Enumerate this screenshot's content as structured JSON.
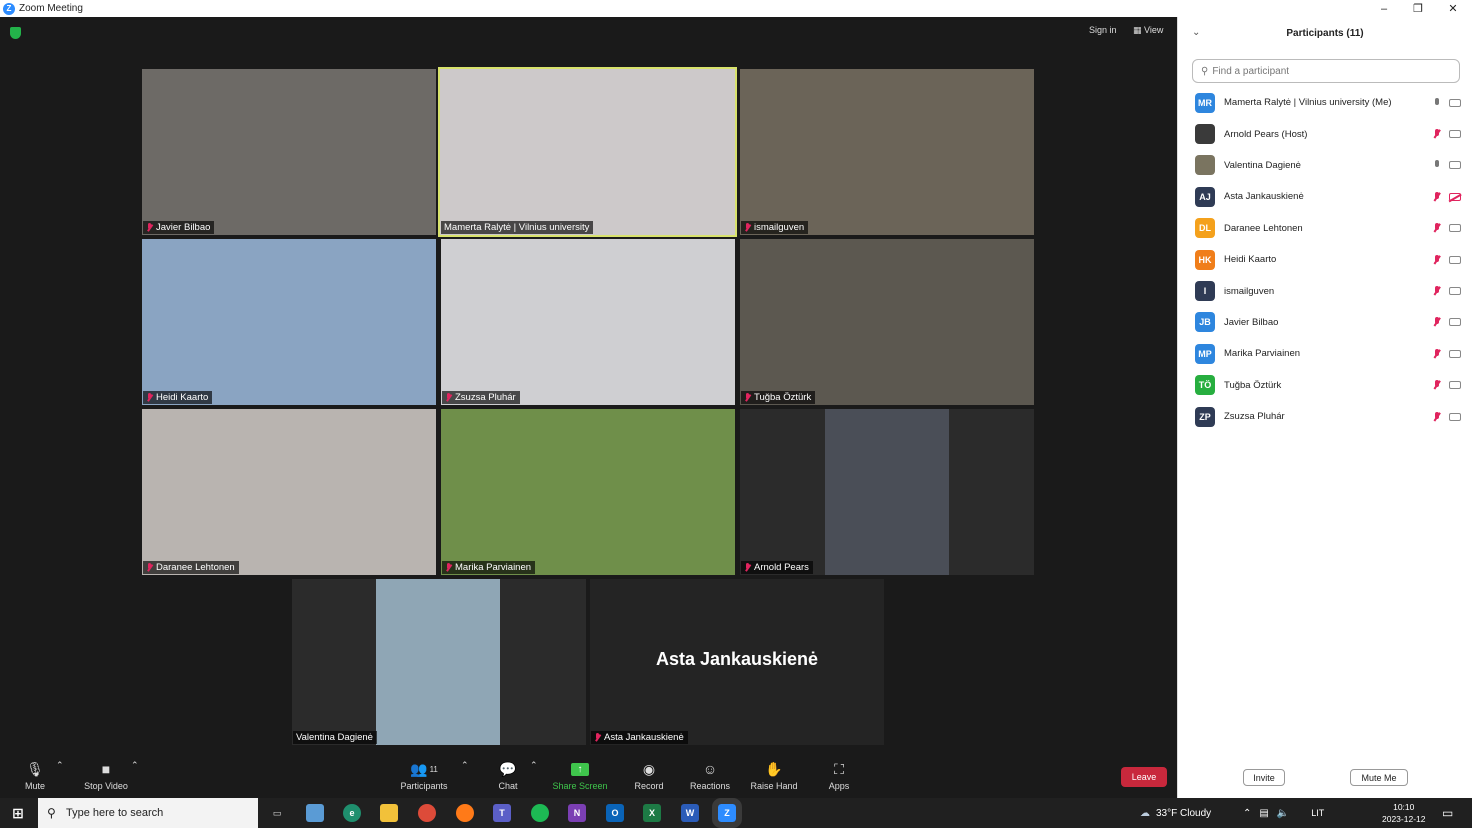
{
  "window": {
    "title": "Zoom Meeting",
    "minimize": "–",
    "restore": "❐",
    "close": "✕"
  },
  "top": {
    "sign_in": "Sign in",
    "view": "View"
  },
  "tiles": [
    {
      "name": "Javier Bilbao",
      "muted": true,
      "bg": "#6d6a66"
    },
    {
      "name": "Mamerta Ralytė | Vilnius university",
      "muted": false,
      "bg": "#cdc9ca",
      "active": true
    },
    {
      "name": "ismailguven",
      "muted": true,
      "bg": "#6b6458"
    },
    {
      "name": "Heidi Kaarto",
      "muted": true,
      "bg": "#8aa4c2"
    },
    {
      "name": "Zsuzsa Pluhár",
      "muted": true,
      "bg": "#cfcfd2"
    },
    {
      "name": "Tuğba Öztürk",
      "muted": true,
      "bg": "#5c5850"
    },
    {
      "name": "Daranee Lehtonen",
      "muted": true,
      "bg": "#b9b4b0"
    },
    {
      "name": "Marika Parviainen",
      "muted": true,
      "bg": "#6f8f4a"
    },
    {
      "name": "Arnold Pears",
      "muted": true,
      "bg": "#2b2b2b"
    },
    {
      "name": "Valentina Dagienė",
      "muted": false,
      "bg": "#2b2b2b"
    },
    {
      "name": "Asta Jankauskienė",
      "muted": true,
      "bg": "#242424",
      "big_name": "Asta Jankauskienė"
    }
  ],
  "toolbar": {
    "mute": "Mute",
    "stop_video": "Stop Video",
    "participants": "Participants",
    "participants_count": "11",
    "chat": "Chat",
    "share_screen": "Share Screen",
    "record": "Record",
    "reactions": "Reactions",
    "raise_hand": "Raise Hand",
    "apps": "Apps",
    "leave": "Leave"
  },
  "panel": {
    "title": "Participants (11)",
    "search_placeholder": "Find a participant",
    "participants": [
      {
        "initials": "MR",
        "name": "Mamerta Ralytė | Vilnius university (Me)",
        "color": "#2e86de",
        "mic": "on",
        "cam": "on"
      },
      {
        "initials": "",
        "name": "Arnold Pears (Host)",
        "color": "#3a3a3a",
        "mic": "off",
        "cam": "on"
      },
      {
        "initials": "",
        "name": "Valentina Dagienė",
        "color": "#7a7460",
        "mic": "on",
        "cam": "on"
      },
      {
        "initials": "AJ",
        "name": "Asta Jankauskienė",
        "color": "#2f3b55",
        "mic": "off",
        "cam": "off"
      },
      {
        "initials": "DL",
        "name": "Daranee Lehtonen",
        "color": "#f4a11c",
        "mic": "off",
        "cam": "on"
      },
      {
        "initials": "HK",
        "name": "Heidi Kaarto",
        "color": "#f07e1a",
        "mic": "off",
        "cam": "on"
      },
      {
        "initials": "I",
        "name": "ismailguven",
        "color": "#2f3b55",
        "mic": "off",
        "cam": "on"
      },
      {
        "initials": "JB",
        "name": "Javier Bilbao",
        "color": "#2e86de",
        "mic": "off",
        "cam": "on"
      },
      {
        "initials": "MP",
        "name": "Marika Parviainen",
        "color": "#2e86de",
        "mic": "off",
        "cam": "on"
      },
      {
        "initials": "TÖ",
        "name": "Tuğba Öztürk",
        "color": "#27ae3f",
        "mic": "off",
        "cam": "on"
      },
      {
        "initials": "ZP",
        "name": "Zsuzsa Pluhár",
        "color": "#2f3b55",
        "mic": "off",
        "cam": "on"
      }
    ],
    "invite": "Invite",
    "mute_me": "Mute Me"
  },
  "taskbar": {
    "search_placeholder": "Type here to search",
    "weather": "33°F  Cloudy",
    "lang": "LIT",
    "time": "10:10",
    "date": "2023-12-12"
  }
}
